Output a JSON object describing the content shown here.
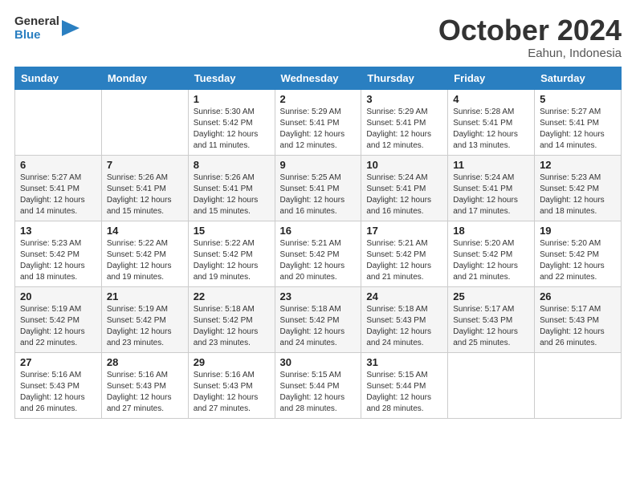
{
  "header": {
    "logo_general": "General",
    "logo_blue": "Blue",
    "month_title": "October 2024",
    "location": "Eahun, Indonesia"
  },
  "weekdays": [
    "Sunday",
    "Monday",
    "Tuesday",
    "Wednesday",
    "Thursday",
    "Friday",
    "Saturday"
  ],
  "weeks": [
    [
      {
        "day": "",
        "info": ""
      },
      {
        "day": "",
        "info": ""
      },
      {
        "day": "1",
        "info": "Sunrise: 5:30 AM\nSunset: 5:42 PM\nDaylight: 12 hours\nand 11 minutes."
      },
      {
        "day": "2",
        "info": "Sunrise: 5:29 AM\nSunset: 5:41 PM\nDaylight: 12 hours\nand 12 minutes."
      },
      {
        "day": "3",
        "info": "Sunrise: 5:29 AM\nSunset: 5:41 PM\nDaylight: 12 hours\nand 12 minutes."
      },
      {
        "day": "4",
        "info": "Sunrise: 5:28 AM\nSunset: 5:41 PM\nDaylight: 12 hours\nand 13 minutes."
      },
      {
        "day": "5",
        "info": "Sunrise: 5:27 AM\nSunset: 5:41 PM\nDaylight: 12 hours\nand 14 minutes."
      }
    ],
    [
      {
        "day": "6",
        "info": "Sunrise: 5:27 AM\nSunset: 5:41 PM\nDaylight: 12 hours\nand 14 minutes."
      },
      {
        "day": "7",
        "info": "Sunrise: 5:26 AM\nSunset: 5:41 PM\nDaylight: 12 hours\nand 15 minutes."
      },
      {
        "day": "8",
        "info": "Sunrise: 5:26 AM\nSunset: 5:41 PM\nDaylight: 12 hours\nand 15 minutes."
      },
      {
        "day": "9",
        "info": "Sunrise: 5:25 AM\nSunset: 5:41 PM\nDaylight: 12 hours\nand 16 minutes."
      },
      {
        "day": "10",
        "info": "Sunrise: 5:24 AM\nSunset: 5:41 PM\nDaylight: 12 hours\nand 16 minutes."
      },
      {
        "day": "11",
        "info": "Sunrise: 5:24 AM\nSunset: 5:41 PM\nDaylight: 12 hours\nand 17 minutes."
      },
      {
        "day": "12",
        "info": "Sunrise: 5:23 AM\nSunset: 5:42 PM\nDaylight: 12 hours\nand 18 minutes."
      }
    ],
    [
      {
        "day": "13",
        "info": "Sunrise: 5:23 AM\nSunset: 5:42 PM\nDaylight: 12 hours\nand 18 minutes."
      },
      {
        "day": "14",
        "info": "Sunrise: 5:22 AM\nSunset: 5:42 PM\nDaylight: 12 hours\nand 19 minutes."
      },
      {
        "day": "15",
        "info": "Sunrise: 5:22 AM\nSunset: 5:42 PM\nDaylight: 12 hours\nand 19 minutes."
      },
      {
        "day": "16",
        "info": "Sunrise: 5:21 AM\nSunset: 5:42 PM\nDaylight: 12 hours\nand 20 minutes."
      },
      {
        "day": "17",
        "info": "Sunrise: 5:21 AM\nSunset: 5:42 PM\nDaylight: 12 hours\nand 21 minutes."
      },
      {
        "day": "18",
        "info": "Sunrise: 5:20 AM\nSunset: 5:42 PM\nDaylight: 12 hours\nand 21 minutes."
      },
      {
        "day": "19",
        "info": "Sunrise: 5:20 AM\nSunset: 5:42 PM\nDaylight: 12 hours\nand 22 minutes."
      }
    ],
    [
      {
        "day": "20",
        "info": "Sunrise: 5:19 AM\nSunset: 5:42 PM\nDaylight: 12 hours\nand 22 minutes."
      },
      {
        "day": "21",
        "info": "Sunrise: 5:19 AM\nSunset: 5:42 PM\nDaylight: 12 hours\nand 23 minutes."
      },
      {
        "day": "22",
        "info": "Sunrise: 5:18 AM\nSunset: 5:42 PM\nDaylight: 12 hours\nand 23 minutes."
      },
      {
        "day": "23",
        "info": "Sunrise: 5:18 AM\nSunset: 5:42 PM\nDaylight: 12 hours\nand 24 minutes."
      },
      {
        "day": "24",
        "info": "Sunrise: 5:18 AM\nSunset: 5:43 PM\nDaylight: 12 hours\nand 24 minutes."
      },
      {
        "day": "25",
        "info": "Sunrise: 5:17 AM\nSunset: 5:43 PM\nDaylight: 12 hours\nand 25 minutes."
      },
      {
        "day": "26",
        "info": "Sunrise: 5:17 AM\nSunset: 5:43 PM\nDaylight: 12 hours\nand 26 minutes."
      }
    ],
    [
      {
        "day": "27",
        "info": "Sunrise: 5:16 AM\nSunset: 5:43 PM\nDaylight: 12 hours\nand 26 minutes."
      },
      {
        "day": "28",
        "info": "Sunrise: 5:16 AM\nSunset: 5:43 PM\nDaylight: 12 hours\nand 27 minutes."
      },
      {
        "day": "29",
        "info": "Sunrise: 5:16 AM\nSunset: 5:43 PM\nDaylight: 12 hours\nand 27 minutes."
      },
      {
        "day": "30",
        "info": "Sunrise: 5:15 AM\nSunset: 5:44 PM\nDaylight: 12 hours\nand 28 minutes."
      },
      {
        "day": "31",
        "info": "Sunrise: 5:15 AM\nSunset: 5:44 PM\nDaylight: 12 hours\nand 28 minutes."
      },
      {
        "day": "",
        "info": ""
      },
      {
        "day": "",
        "info": ""
      }
    ]
  ]
}
